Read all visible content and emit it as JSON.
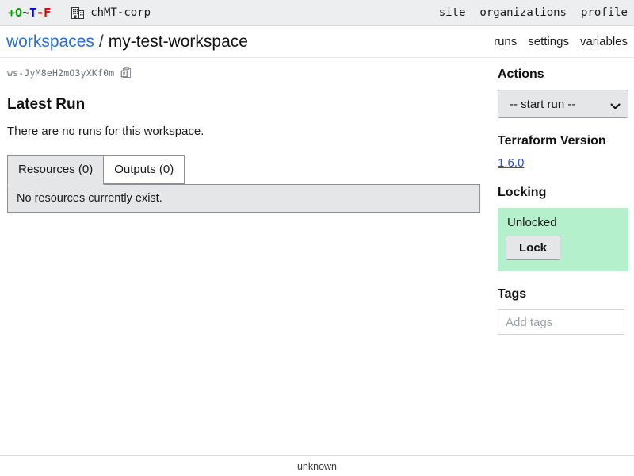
{
  "topbar": {
    "brand": {
      "parts": [
        {
          "text": "+",
          "color": "#00a000"
        },
        {
          "text": "O",
          "color": "#00a000"
        },
        {
          "text": "~",
          "color": "#111111"
        },
        {
          "text": "T",
          "color": "#0000ee"
        },
        {
          "text": "-",
          "color": "#e00000"
        },
        {
          "text": "F",
          "color": "#e00000"
        }
      ],
      "full_text": "+O~T-F"
    },
    "org_icon": "building-icon",
    "org_name": "chMT-corp",
    "nav": [
      {
        "label": "site"
      },
      {
        "label": "organizations"
      },
      {
        "label": "profile"
      }
    ]
  },
  "breadcrumb": {
    "root_label": "workspaces",
    "separator": "/",
    "current_label": "my-test-workspace",
    "root_color": "#2b6ed6"
  },
  "subnav": [
    {
      "label": "runs"
    },
    {
      "label": "settings"
    },
    {
      "label": "variables"
    }
  ],
  "main": {
    "workspace_id": "ws-JyM8eH2mO3yXKf0m",
    "copy_icon": "copy-clipboard-icon",
    "latest_run_heading": "Latest Run",
    "no_runs_text": "There are no runs for this workspace.",
    "tabs": [
      {
        "label": "Resources (0)",
        "active": true
      },
      {
        "label": "Outputs (0)",
        "active": false
      }
    ],
    "panel_text": "No resources currently exist."
  },
  "sidebar": {
    "actions": {
      "heading": "Actions",
      "selected_option": "-- start run --",
      "options": [
        "-- start run --"
      ],
      "chevron_icon": "chevron-down-icon"
    },
    "terraform_version": {
      "heading": "Terraform Version",
      "value": "1.6.0",
      "link_color": "#2b4fd6"
    },
    "locking": {
      "heading": "Locking",
      "status": "Unlocked",
      "button_label": "Lock",
      "panel_color": "#b4f0cb"
    },
    "tags": {
      "heading": "Tags",
      "placeholder": "Add tags",
      "value": ""
    }
  },
  "footer": {
    "text": "unknown"
  }
}
